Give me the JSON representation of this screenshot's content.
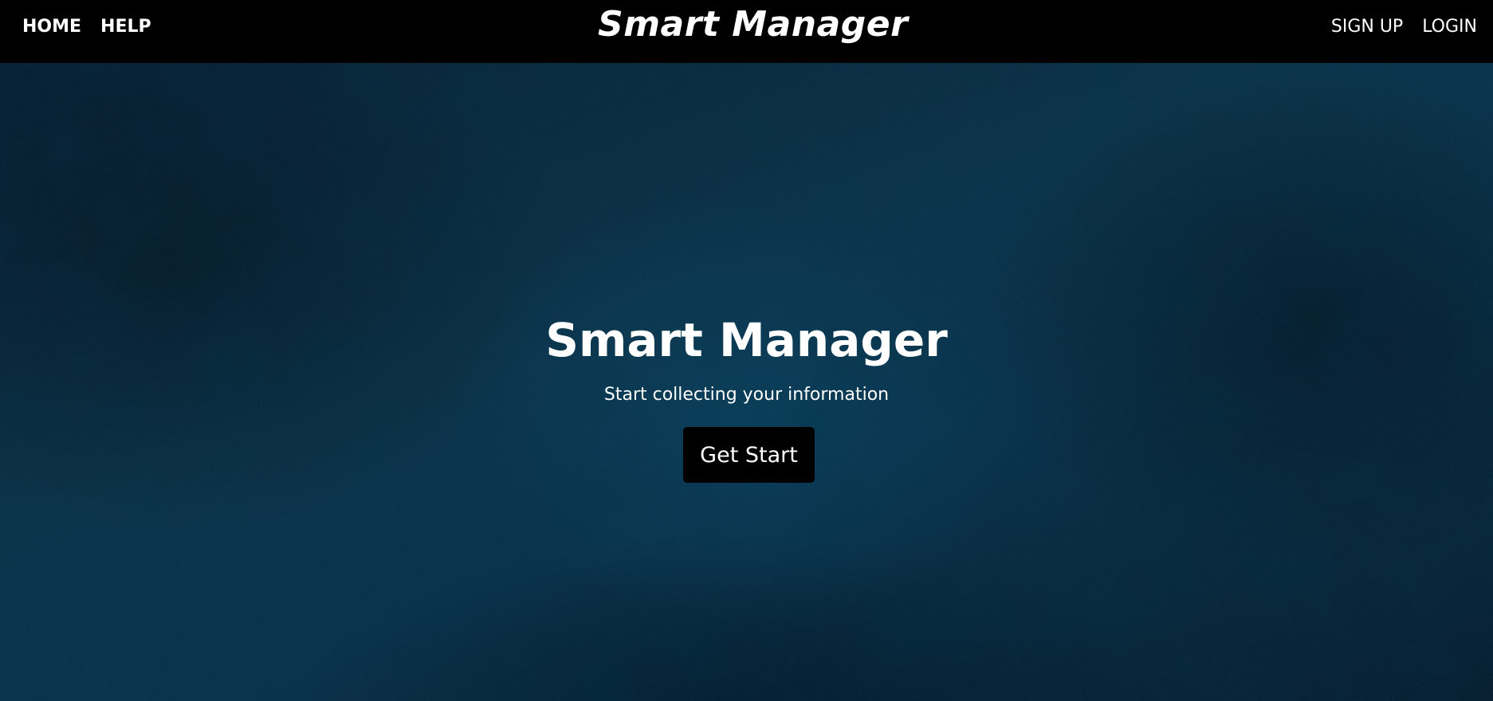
{
  "navbar": {
    "left_links": [
      {
        "label": "HOME"
      },
      {
        "label": "HELP"
      }
    ],
    "brand": "Smart Manager",
    "right_links": [
      {
        "label": "SIGN UP"
      },
      {
        "label": "LOGIN"
      }
    ],
    "background_color": "#000000"
  },
  "hero": {
    "title": "Smart Manager",
    "subtitle": "Start collecting your information",
    "cta_label": "Get Start",
    "background_color": "#0a2b40"
  }
}
